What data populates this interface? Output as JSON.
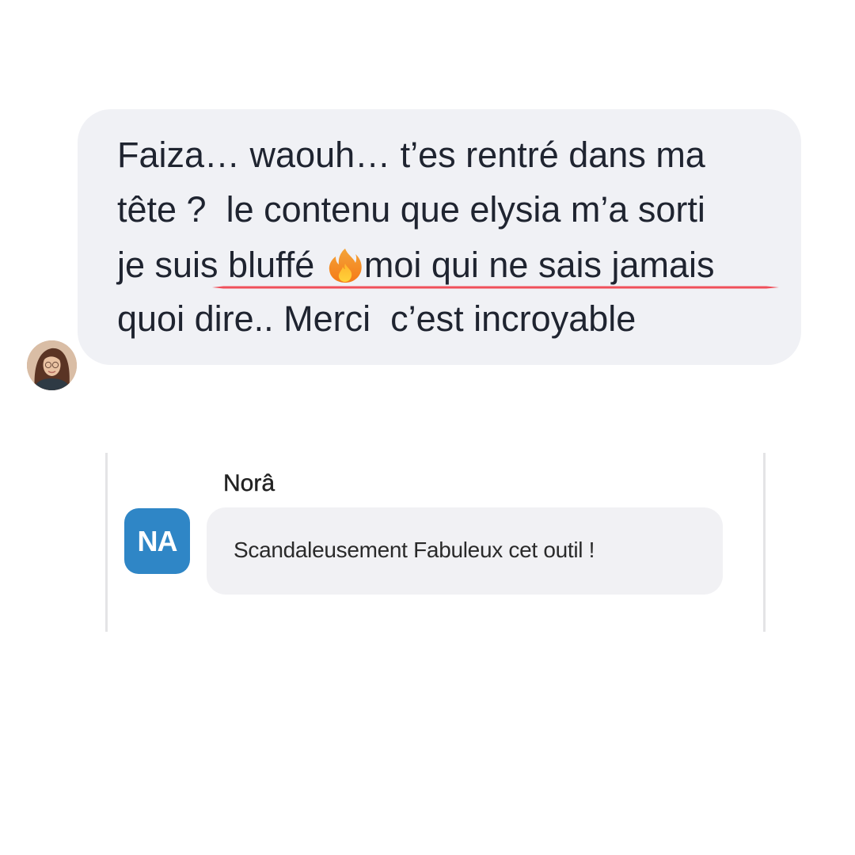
{
  "message_main": {
    "line_1": "Faiza… waouh… t’es rentré dans ma",
    "line_2": "tête ?  le contenu que elysia m’a sorti",
    "line_3_before_icon": "je suis bluffé ",
    "line_3_icon": "fire-emoji",
    "line_3_after_icon": "moi qui ne sais jamais",
    "line_4": "quoi dire.. Merci  c’est incroyable",
    "bubble_color": "#f0f1f5",
    "highlight_color": "#f0505a"
  },
  "message_reply": {
    "author": "Norâ",
    "avatar_initials": "NA",
    "avatar_color": "#2f86c6",
    "text": "Scandaleusement Fabuleux cet outil !"
  }
}
